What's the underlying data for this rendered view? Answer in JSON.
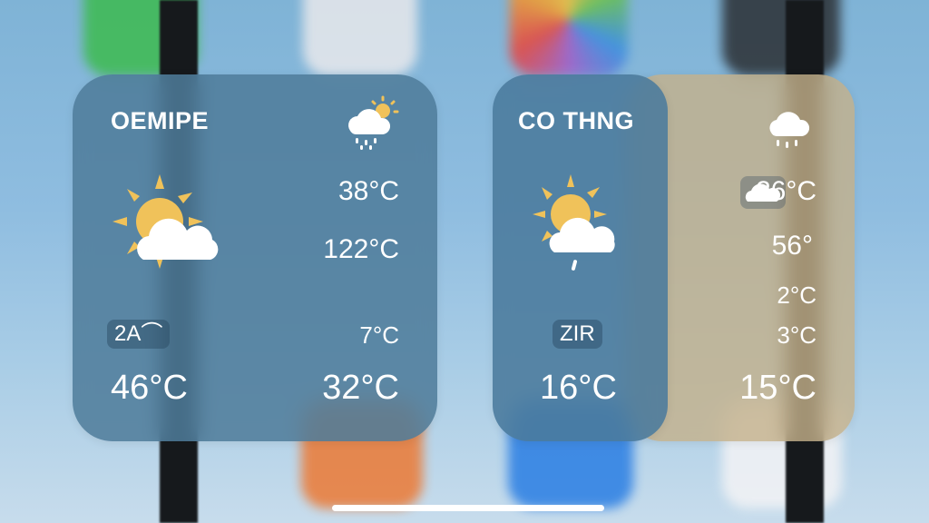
{
  "widgets": [
    {
      "city": "OEMIPE",
      "temps": [
        "38°C",
        "122°C",
        "7°C",
        "32°C"
      ],
      "badge": "2A⌒",
      "main_temp": "46°C",
      "icons": [
        "rain-cloud-sun-icon",
        "sun-behind-cloud-icon"
      ]
    },
    {
      "city": "CO THNG",
      "badge": "ZIR",
      "main_temp": "16°C",
      "icons": [
        "rain-cloud-icon",
        "sun-cloud-rain-icon"
      ]
    },
    {
      "temps": [
        "26°C",
        "56°",
        "2°C",
        "3°C",
        "15°C"
      ],
      "icons": [
        "cloud-icon"
      ]
    }
  ],
  "colors": {
    "sun": "#f0c25a",
    "widget_blue": "#4e7c9a",
    "widget_tan": "#c4b08a"
  }
}
